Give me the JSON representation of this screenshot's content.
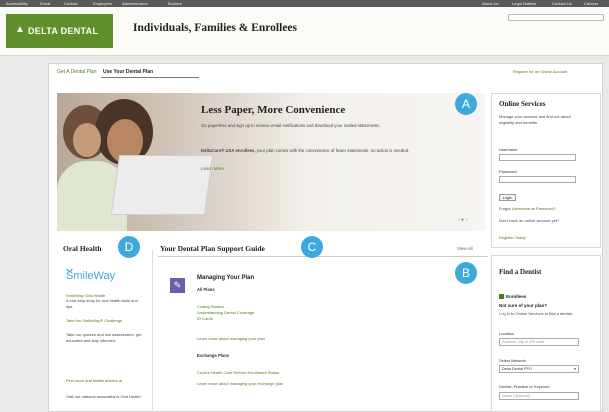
{
  "topbar": {
    "links_left": [
      "Accessibility",
      "Enroll",
      "Contact",
      "Employers",
      "Administrators",
      "Brokers"
    ],
    "links_right": [
      "About Us",
      "Legal Notices",
      "Contact Us",
      "Careers"
    ]
  },
  "header": {
    "logo_text": "DELTA DENTAL",
    "site_title": "Individuals, Families & Enrollees",
    "search_placeholder": ""
  },
  "tabs": [
    {
      "label": "Get A Dental Plan",
      "active": false
    },
    {
      "label": "Use Your Dental Plan",
      "active": true
    }
  ],
  "register_link": "Register for an Online Account",
  "hero": {
    "title": "Less Paper, More Convenience",
    "para1": "Go paperless and sign up to receive email notifications and download your mailed statements.",
    "para2_bold": "DeltaCare® USA enrollees,",
    "para2": " your plan comes with the convenience of fewer statements; no action is needed.",
    "more_link": "Learn More",
    "dots": "○●○"
  },
  "badges": {
    "a": "A",
    "b": "B",
    "c": "C",
    "d": "D"
  },
  "online_services": {
    "title": "Online Services",
    "intro": "Manage your account and find out about eligibility and benefits.",
    "username_label": "Username",
    "password_label": "Password",
    "login_button": "Login",
    "forgot_prefix": "Forgot ",
    "forgot_username": "Username",
    "forgot_or": " or ",
    "forgot_password": "Password?",
    "no_account": "Don't have an online account yet?",
    "register_today": "Register Today"
  },
  "oral_health": {
    "title": "Oral Health",
    "brand": "SmileWay",
    "items": [
      {
        "title": "SmileWay Oral Health",
        "desc": "A one-stop shop for oral health tools and tips."
      },
      {
        "title": "Take the SmileWay® Challenge",
        "desc": "Take our quizzes and risk assessment, get educated and stay informed."
      },
      {
        "title": "Find more oral health articles at",
        "desc": "Visit our national association's Oral Health"
      }
    ]
  },
  "support_guide": {
    "title": "Your Dental Plan Support Guide",
    "view_all": "View All",
    "section_title": "Managing Your Plan",
    "all_plans_label": "All Plans",
    "all_plans_links": [
      "Coding Started",
      "Understanding Dental Coverage",
      "ID Cards"
    ],
    "learn_more_1": "Learn more about managing your plan",
    "exchange_label": "Exchange Plans",
    "exchange_links": [
      "Covers Health Care Reform Enrollment Status"
    ],
    "learn_more_2": "Learn more about managing your exchange plan"
  },
  "find_dentist": {
    "title": "Find a Dentist",
    "enrollees_label": "Enrollees",
    "question": "Not sure of your plan?",
    "log_in_prefix": "Log in",
    "log_in_suffix": " to Online Services to find a dentist.",
    "location_label": "Location",
    "location_placeholder": "Address, city or ZIP code",
    "network_label": "Select Network",
    "network_value": "Delta Dental PPO",
    "name_label": "Dentist, Practice or Keyword",
    "name_placeholder": "Name (Optional)"
  },
  "colors": {
    "brand_green": "#5f8f2a",
    "link_green": "#4a7a1f",
    "badge_blue": "#3fa9dc",
    "plan_icon": "#6b5fa8"
  }
}
